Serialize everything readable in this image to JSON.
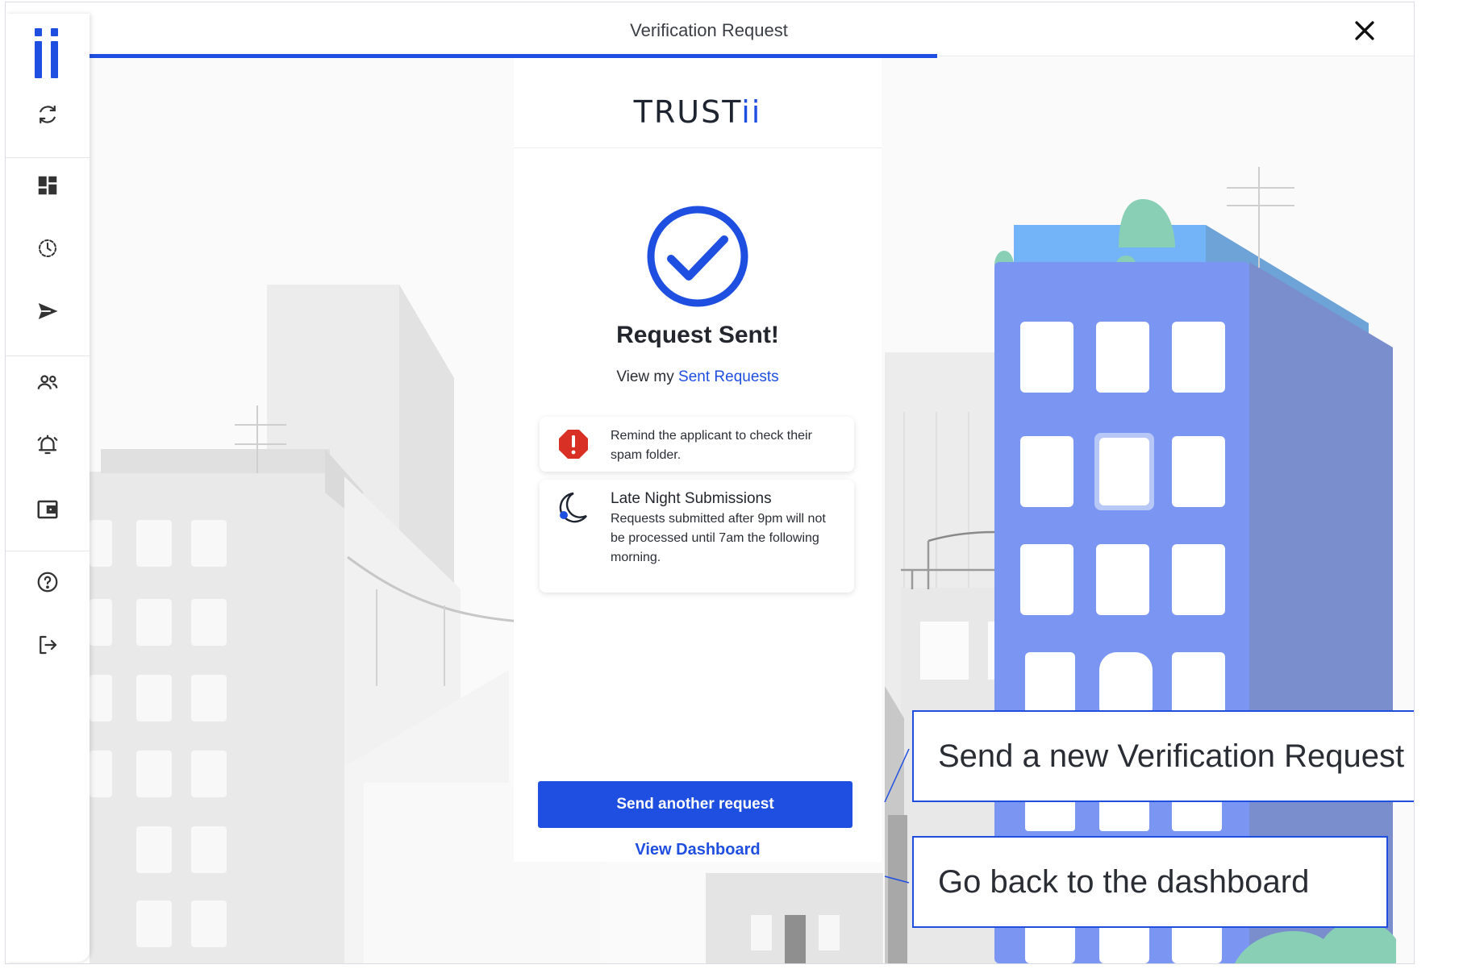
{
  "window": {
    "title": "Verification Request",
    "progress_percent": 64
  },
  "sidebar": {
    "items": [
      {
        "name": "refresh-icon"
      },
      {
        "name": "dashboard-icon"
      },
      {
        "name": "history-icon"
      },
      {
        "name": "send-icon"
      },
      {
        "name": "users-icon"
      },
      {
        "name": "alarm-icon"
      },
      {
        "name": "wallet-icon"
      },
      {
        "name": "help-icon"
      },
      {
        "name": "logout-icon"
      }
    ]
  },
  "panel": {
    "logo_main": "TRUST",
    "logo_accent": "ii",
    "heading": "Request Sent!",
    "view_prefix": "View my",
    "view_link": "Sent Requests",
    "notice1": {
      "text": "Remind the applicant to check their spam folder.",
      "icon": "alert-octagon-icon"
    },
    "notice2": {
      "title": "Late Night Submissions",
      "text": "Requests submitted after 9pm will not be processed until 7am the following morning.",
      "icon": "moon-icon"
    },
    "primary_button": "Send another request",
    "secondary_link": "View Dashboard"
  },
  "callouts": {
    "send": "Send a new Verification Request",
    "dashboard": "Go back to the dashboard"
  },
  "colors": {
    "accent": "#1f4fe0",
    "building": "#7b96f2",
    "alert": "#d93025"
  }
}
